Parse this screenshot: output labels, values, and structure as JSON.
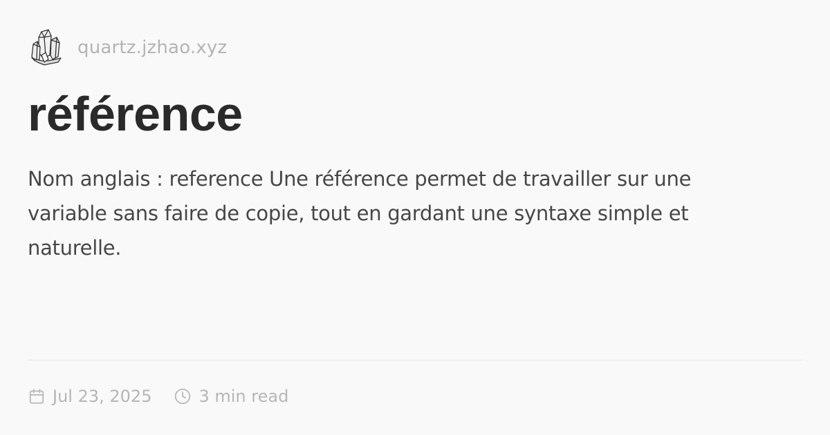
{
  "site": {
    "url": "quartz.jzhao.xyz",
    "logo_icon": "crystal-logo-icon"
  },
  "page": {
    "title": "référence",
    "description": "Nom anglais : reference Une référence permet de travailler sur une variable sans faire de copie, tout en gardant une syntaxe simple et naturelle."
  },
  "meta": {
    "date": "Jul 23, 2025",
    "date_icon": "calendar-icon",
    "reading_time": "3 min read",
    "reading_time_icon": "clock-icon"
  },
  "colors": {
    "background": "#faf9fa",
    "title": "#2a2a2a",
    "body_text": "#474747",
    "muted_text": "#b4b4b4",
    "divider": "#e6e4e6"
  }
}
